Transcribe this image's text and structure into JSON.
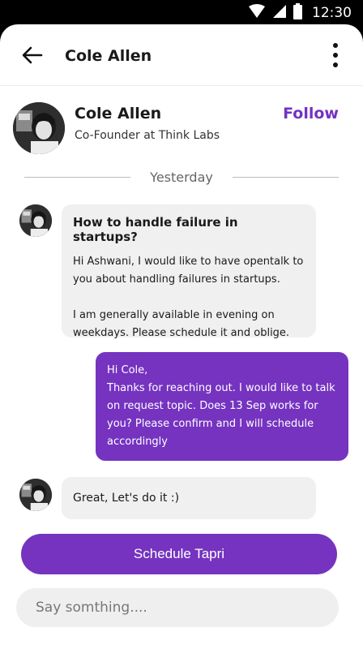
{
  "status_bar": {
    "time": "12:30",
    "icons": [
      "wifi-icon",
      "cellular-signal-icon",
      "battery-icon"
    ]
  },
  "app_bar": {
    "back_icon": "arrow-left-icon",
    "title": "Cole Allen",
    "menu_icon": "more-vertical-icon"
  },
  "profile": {
    "name": "Cole Allen",
    "role": "Co-Founder at Think Labs",
    "follow_label": "Follow"
  },
  "date_divider": "Yesterday",
  "messages": [
    {
      "direction": "incoming",
      "title": "How to handle failure in startups?",
      "paragraphs": [
        "Hi Ashwani, I would like to have opentalk to you about handling failures in startups.",
        "I am generally available in evening on weekdays. Please schedule it and oblige."
      ]
    },
    {
      "direction": "outgoing",
      "paragraphs": [
        "Hi Cole,",
        "Thanks for reaching out. I would like to talk on request topic. Does 13 Sep works for you? Please confirm and I will schedule accordingly"
      ]
    },
    {
      "direction": "incoming",
      "text": "Great, Let's do it :)"
    }
  ],
  "schedule_button": "Schedule Tapri",
  "compose": {
    "placeholder": "Say somthing....",
    "value": ""
  },
  "colors": {
    "accent": "#7533c0",
    "follow": "#7432bf",
    "incoming_bubble": "#f0f0f0",
    "compose_bg": "#efefef"
  }
}
